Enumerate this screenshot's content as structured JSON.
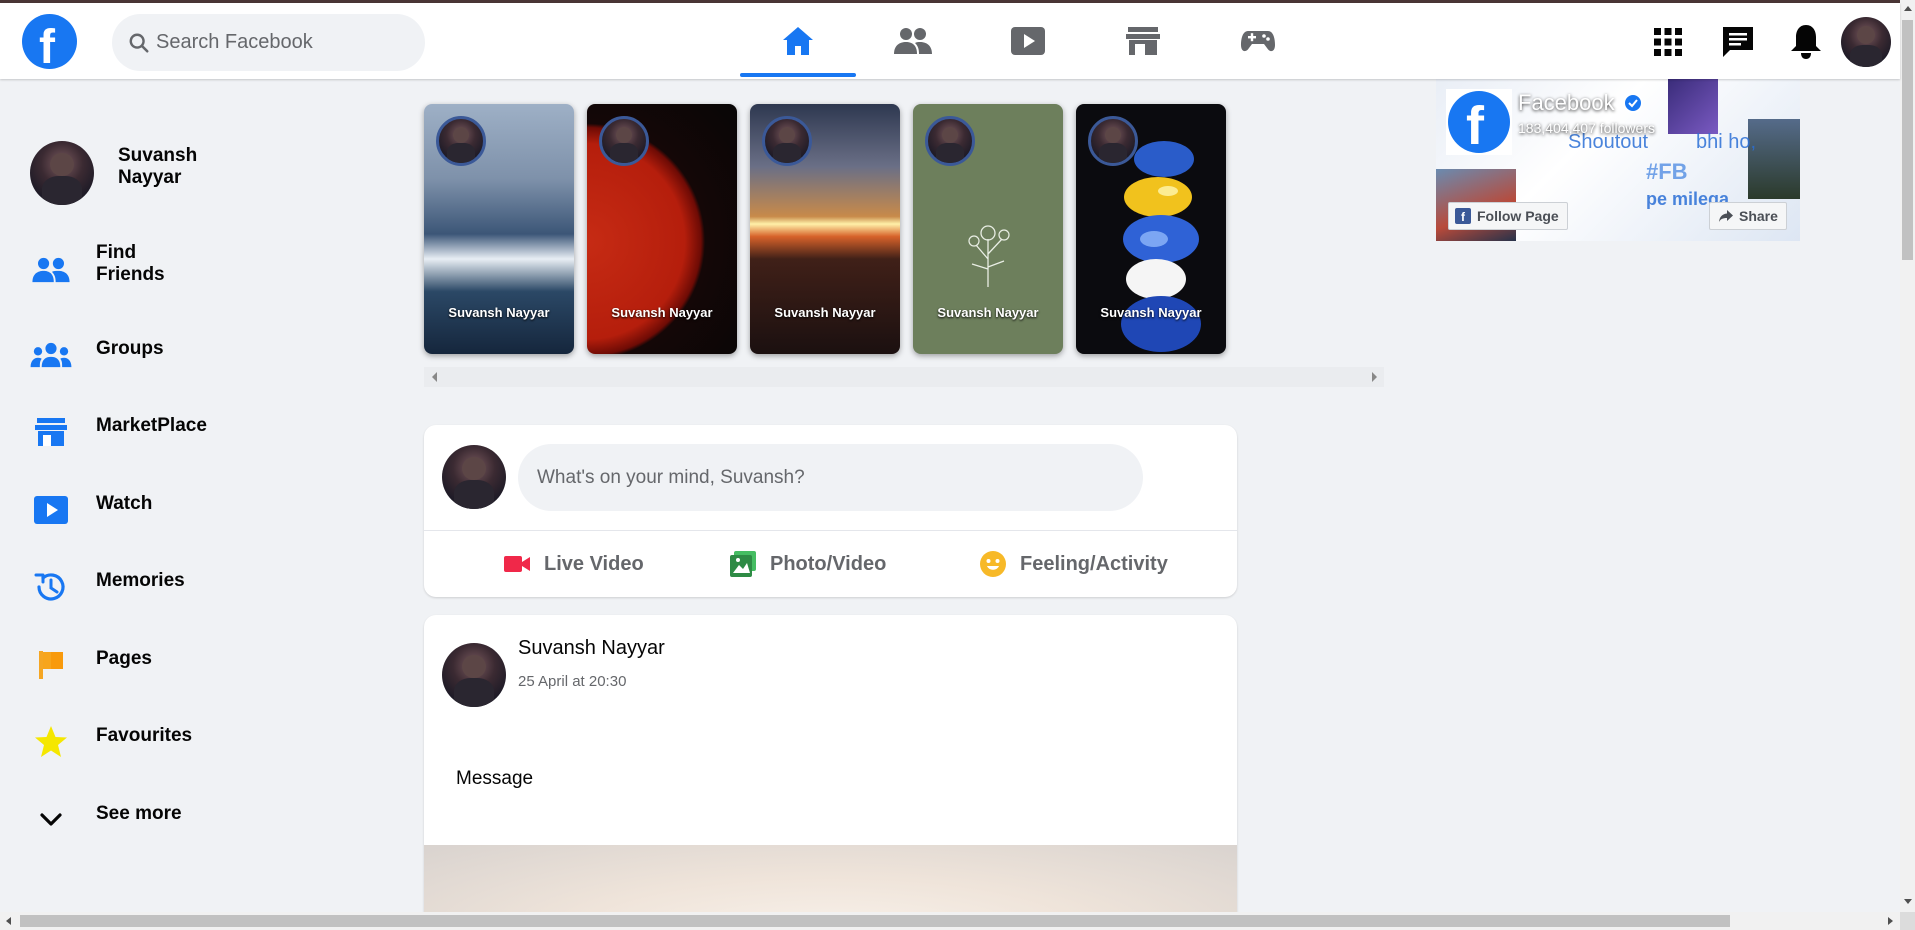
{
  "header": {
    "logo_letter": "f",
    "search_placeholder": "Search Facebook",
    "nav_tabs": [
      "home",
      "friends",
      "watch",
      "marketplace",
      "gaming"
    ],
    "active_tab": "home"
  },
  "user": {
    "first_line": "Suvansh",
    "second_line": "Nayyar",
    "full_name": "Suvansh Nayyar"
  },
  "sidebar": {
    "items": [
      {
        "label_1": "Find",
        "label_2": "Friends",
        "icon": "friends-icon"
      },
      {
        "label": "Groups",
        "icon": "groups-icon"
      },
      {
        "label": "MarketPlace",
        "icon": "marketplace-icon"
      },
      {
        "label": "Watch",
        "icon": "watch-icon"
      },
      {
        "label": "Memories",
        "icon": "memories-icon"
      },
      {
        "label": "Pages",
        "icon": "flag-icon"
      },
      {
        "label": "Favourites",
        "icon": "star-icon"
      },
      {
        "label": "See more",
        "icon": "chevron-down-icon"
      }
    ]
  },
  "stories": [
    {
      "name": "Suvansh Nayyar",
      "theme": "ocean waves"
    },
    {
      "name": "Suvansh Nayyar",
      "theme": "red planet"
    },
    {
      "name": "Suvansh Nayyar",
      "theme": "sunset sea"
    },
    {
      "name": "Suvansh Nayyar",
      "theme": "flower sketch"
    },
    {
      "name": "Suvansh Nayyar",
      "theme": "glass spheres"
    }
  ],
  "composer": {
    "placeholder": "What's on your mind, Suvansh?",
    "actions": [
      "Live Video",
      "Photo/Video",
      "Feeling/Activity"
    ]
  },
  "post": {
    "author": "Suvansh Nayyar",
    "timestamp": "25 April at 20:30",
    "message": "Message"
  },
  "page_plugin": {
    "name": "Facebook",
    "followers": "183,404,407 followers",
    "follow_label": "Follow Page",
    "share_label": "Share",
    "promo_1": "Shoutout",
    "promo_2": "bhi ho,",
    "promo_3": "#FB",
    "promo_4": "pe milega"
  },
  "colors": {
    "brand": "#1877f2",
    "background": "#f0f2f5",
    "live_red": "#f02849",
    "photo_green": "#45bd62",
    "feeling_yellow": "#f7b928"
  }
}
